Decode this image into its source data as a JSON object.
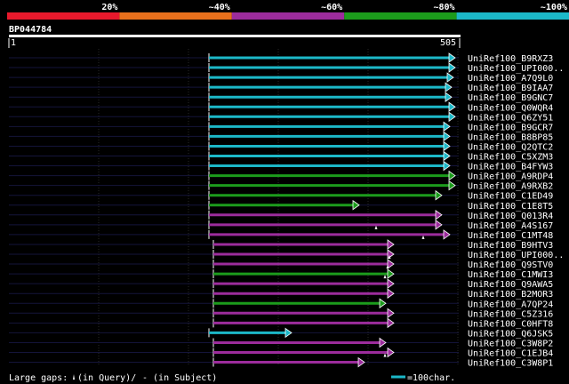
{
  "header": {
    "scale_labels": [
      "20%",
      "~40%",
      "~60%",
      "~80%",
      "~100%"
    ],
    "scale_colors": [
      "#e8192c",
      "#e8701c",
      "#9c2c9c",
      "#1c9c1c",
      "#1cb8c8"
    ],
    "query_name": "BP044784",
    "query_start": "1",
    "query_end": "505"
  },
  "footer": {
    "large_gaps_label": "Large gaps:",
    "in_query_label": "(in Query)/",
    "in_subject_label": "- (in Subject)",
    "scale_note": "=100char."
  },
  "hits": [
    {
      "label": "UniRef100_B9RXZ3",
      "start": 235,
      "end": 512,
      "color": "#1cb8c8",
      "gap": null
    },
    {
      "label": "UniRef100_UPI000..",
      "start": 235,
      "end": 512,
      "color": "#1cb8c8",
      "gap": null
    },
    {
      "label": "UniRef100_A7Q9L0",
      "start": 235,
      "end": 510,
      "color": "#1cb8c8",
      "gap": null
    },
    {
      "label": "UniRef100_B9IAA7",
      "start": 235,
      "end": 508,
      "color": "#1cb8c8",
      "gap": null
    },
    {
      "label": "UniRef100_B9GNC7",
      "start": 235,
      "end": 508,
      "color": "#1cb8c8",
      "gap": null
    },
    {
      "label": "UniRef100_Q0WQR4",
      "start": 235,
      "end": 512,
      "color": "#1cb8c8",
      "gap": null
    },
    {
      "label": "UniRef100_Q6ZY51",
      "start": 235,
      "end": 512,
      "color": "#1cb8c8",
      "gap": null
    },
    {
      "label": "UniRef100_B9GCR7",
      "start": 235,
      "end": 506,
      "color": "#1cb8c8",
      "gap": null
    },
    {
      "label": "UniRef100_B8BP85",
      "start": 235,
      "end": 506,
      "color": "#1cb8c8",
      "gap": null
    },
    {
      "label": "UniRef100_Q2QTC2",
      "start": 235,
      "end": 506,
      "color": "#1cb8c8",
      "gap": null
    },
    {
      "label": "UniRef100_C5XZM3",
      "start": 235,
      "end": 506,
      "color": "#1cb8c8",
      "gap": null
    },
    {
      "label": "UniRef100_B4FYW3",
      "start": 235,
      "end": 506,
      "color": "#1cb8c8",
      "gap": null
    },
    {
      "label": "UniRef100_A9RDP4",
      "start": 235,
      "end": 512,
      "color": "#1c9c1c",
      "gap": null
    },
    {
      "label": "UniRef100_A9RXB2",
      "start": 235,
      "end": 512,
      "color": "#1c9c1c",
      "gap": null
    },
    {
      "label": "UniRef100_C1ED49",
      "start": 235,
      "end": 497,
      "color": "#1c9c1c",
      "gap": null
    },
    {
      "label": "UniRef100_C1E8T5",
      "start": 235,
      "end": 404,
      "color": "#1c9c1c",
      "gap": null
    },
    {
      "label": "UniRef100_Q013R4",
      "start": 235,
      "end": 497,
      "color": "#9c2c9c",
      "gap": null
    },
    {
      "label": "UniRef100_A4S167",
      "start": 235,
      "end": 497,
      "color": "#9c2c9c",
      "gap": 423
    },
    {
      "label": "UniRef100_C1MT48",
      "start": 235,
      "end": 506,
      "color": "#9c2c9c",
      "gap": 476
    },
    {
      "label": "UniRef100_B9HTV3",
      "start": 240,
      "end": 443,
      "color": "#9c2c9c",
      "gap": null
    },
    {
      "label": "UniRef100_UPI000..",
      "start": 240,
      "end": 443,
      "color": "#9c2c9c",
      "gap": 438
    },
    {
      "label": "UniRef100_Q9STV0",
      "start": 240,
      "end": 443,
      "color": "#9c2c9c",
      "gap": 436
    },
    {
      "label": "UniRef100_C1MWI3",
      "start": 240,
      "end": 443,
      "color": "#1c9c1c",
      "gap": 433
    },
    {
      "label": "UniRef100_Q9AWA5",
      "start": 240,
      "end": 443,
      "color": "#9c2c9c",
      "gap": null
    },
    {
      "label": "UniRef100_B2MOR3",
      "start": 240,
      "end": 443,
      "color": "#9c2c9c",
      "gap": null
    },
    {
      "label": "UniRef100_A7QP24",
      "start": 240,
      "end": 434,
      "color": "#1c9c1c",
      "gap": null
    },
    {
      "label": "UniRef100_C5Z316",
      "start": 240,
      "end": 443,
      "color": "#9c2c9c",
      "gap": null
    },
    {
      "label": "UniRef100_C0HFT8",
      "start": 240,
      "end": 443,
      "color": "#9c2c9c",
      "gap": null
    },
    {
      "label": "UniRef100_Q6JSK5",
      "start": 235,
      "end": 328,
      "color": "#1cb8c8",
      "gap": null
    },
    {
      "label": "UniRef100_C3W8P2",
      "start": 240,
      "end": 434,
      "color": "#9c2c9c",
      "gap": null
    },
    {
      "label": "UniRef100_C1EJB4",
      "start": 240,
      "end": 443,
      "color": "#9c2c9c",
      "gap": 433
    },
    {
      "label": "UniRef100_C3W8P1",
      "start": 240,
      "end": 410,
      "color": "#9c2c9c",
      "gap": null
    }
  ]
}
